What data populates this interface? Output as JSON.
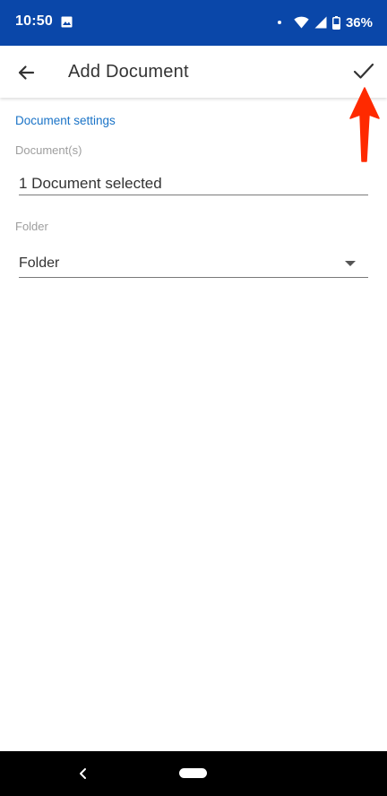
{
  "status_bar": {
    "time": "10:50",
    "battery": "36%",
    "background_color": "#0a47a9",
    "icons": [
      "image-icon",
      "notification-dot-icon",
      "wifi-icon",
      "cellular-signal-icon",
      "battery-icon"
    ]
  },
  "app_bar": {
    "title": "Add Document",
    "back_icon": "arrow-left-icon",
    "confirm_icon": "checkmark-icon"
  },
  "form": {
    "section_header": "Document settings",
    "section_header_color": "#1a73c7",
    "documents": {
      "label": "Document(s)",
      "value": "1 Document selected"
    },
    "folder": {
      "label": "Folder",
      "value": "Folder",
      "icon": "dropdown-triangle-icon"
    }
  },
  "annotation": {
    "color": "#ff2a00"
  },
  "nav_bar": {
    "icons": [
      "nav-back-icon",
      "nav-home-pill"
    ]
  }
}
